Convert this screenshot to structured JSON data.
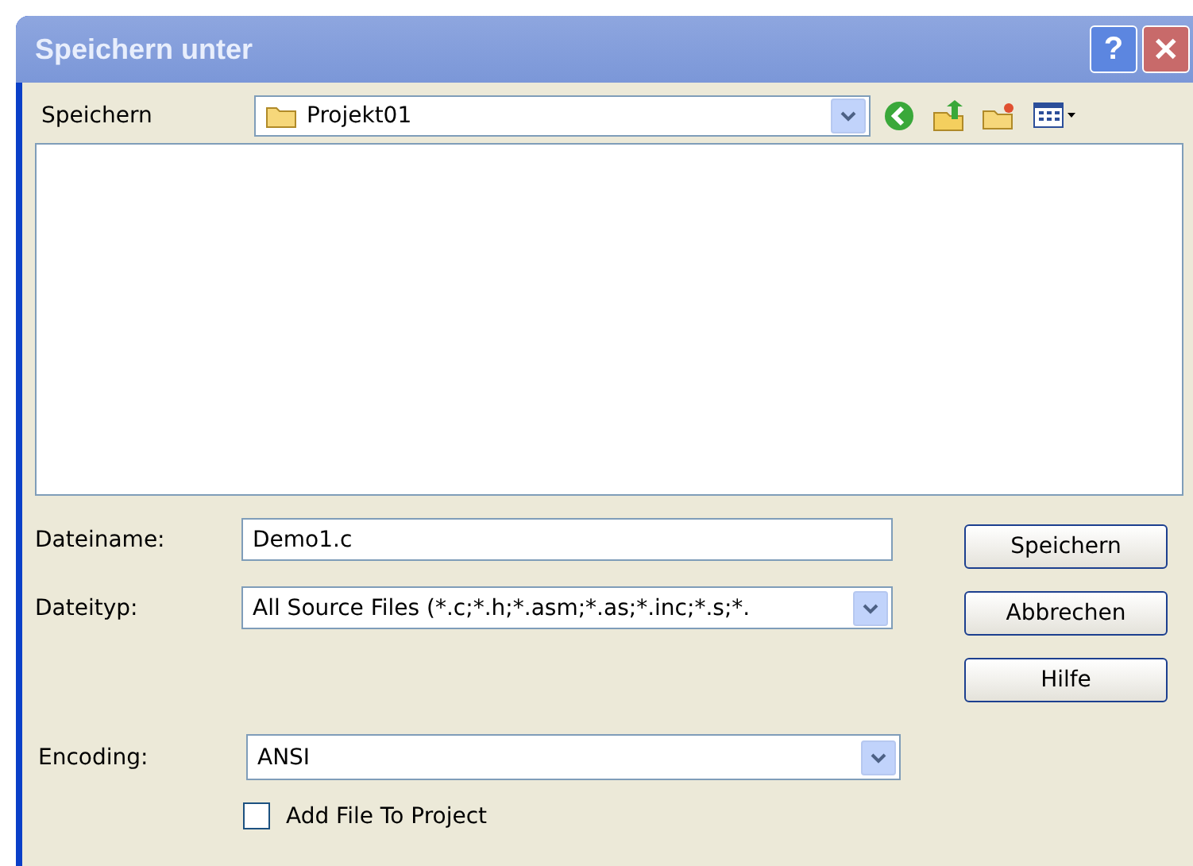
{
  "window": {
    "title": "Speichern unter",
    "title_buttons": [
      "?",
      "✕"
    ]
  },
  "save_in": {
    "label": "Speichern",
    "value": "Projekt01"
  },
  "filename": {
    "label": "Dateiname:",
    "value": "Demo1.c"
  },
  "filetype": {
    "label": "Dateityp:",
    "value": "All Source Files (*.c;*.h;*.asm;*.as;*.inc;*.s;*."
  },
  "encoding": {
    "label": "Encoding:",
    "value": "ANSI"
  },
  "buttons": [
    "Speichern",
    "Abbrechen",
    "Hilfe"
  ],
  "add_to_project": {
    "label": "Add File To Project",
    "checked": false
  }
}
